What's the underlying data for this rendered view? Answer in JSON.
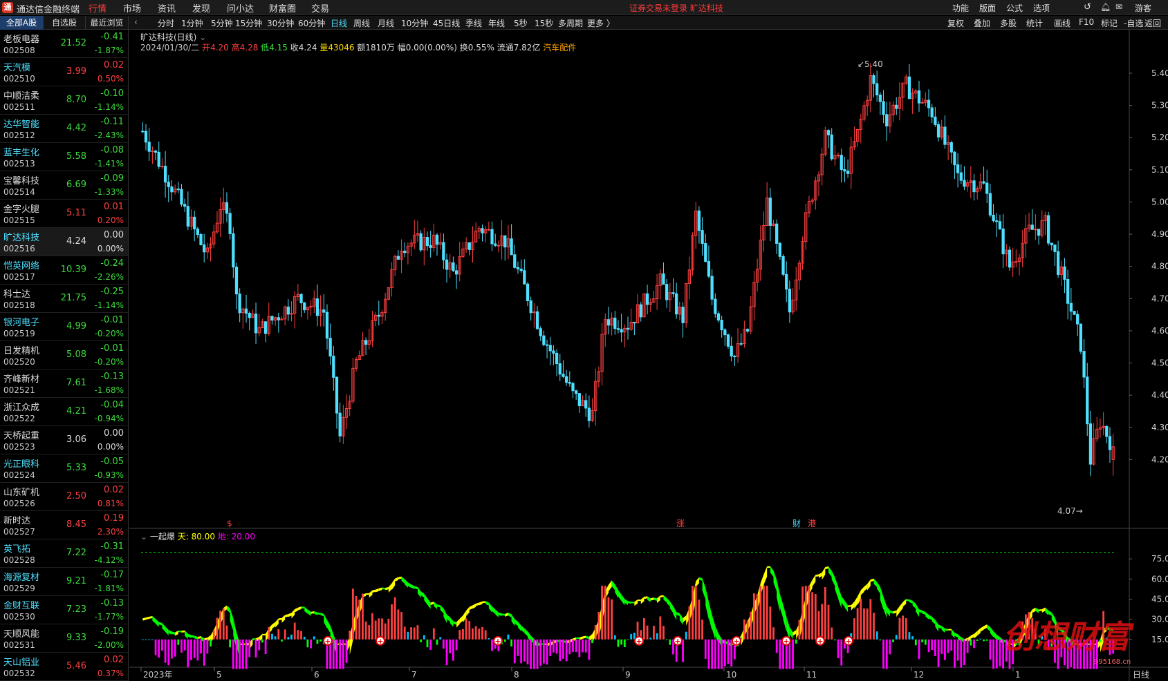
{
  "app": {
    "title": "通达信金融终端",
    "logo": "通"
  },
  "menu": [
    "行情",
    "市场",
    "资讯",
    "发现",
    "问小达",
    "财富圈",
    "交易"
  ],
  "notice": "证券交易未登录  旷达科技",
  "top_right": [
    "功能",
    "版面",
    "公式",
    "选项"
  ],
  "user": "游客",
  "left_tabs": [
    "全部A股",
    "自选股",
    "最近浏览"
  ],
  "periods": [
    "分时",
    "1分钟",
    "5分钟",
    "15分钟",
    "30分钟",
    "60分钟",
    "日线",
    "周线",
    "月线",
    "10分钟",
    "45日线",
    "季线",
    "年线",
    "5秒",
    "15秒",
    "多周期",
    "更多 〉"
  ],
  "right_tools": [
    "复权",
    "叠加",
    "多股",
    "统计",
    "画线",
    "F10",
    "标记",
    "-自选",
    "返回"
  ],
  "stocks": [
    {
      "name": "老板电器",
      "code": "002508",
      "price": "21.52",
      "chg": "-0.41",
      "pct": "-1.87%",
      "dir": "dn",
      "cy": false
    },
    {
      "name": "天汽模",
      "code": "002510",
      "price": "3.99",
      "chg": "0.02",
      "pct": "0.50%",
      "dir": "up",
      "cy": true
    },
    {
      "name": "中顺洁柔",
      "code": "002511",
      "price": "8.70",
      "chg": "-0.10",
      "pct": "-1.14%",
      "dir": "dn",
      "cy": false
    },
    {
      "name": "达华智能",
      "code": "002512",
      "price": "4.42",
      "chg": "-0.11",
      "pct": "-2.43%",
      "dir": "dn",
      "cy": true
    },
    {
      "name": "蓝丰生化",
      "code": "002513",
      "price": "5.58",
      "chg": "-0.08",
      "pct": "-1.41%",
      "dir": "dn",
      "cy": true
    },
    {
      "name": "宝馨科技",
      "code": "002514",
      "price": "6.69",
      "chg": "-0.09",
      "pct": "-1.33%",
      "dir": "dn",
      "cy": false
    },
    {
      "name": "金字火腿",
      "code": "002515",
      "price": "5.11",
      "chg": "0.01",
      "pct": "0.20%",
      "dir": "up",
      "cy": false
    },
    {
      "name": "旷达科技",
      "code": "002516",
      "price": "4.24",
      "chg": "0.00",
      "pct": "0.00%",
      "dir": "eq",
      "cy": true
    },
    {
      "name": "恺英网络",
      "code": "002517",
      "price": "10.39",
      "chg": "-0.24",
      "pct": "-2.26%",
      "dir": "dn",
      "cy": true
    },
    {
      "name": "科士达",
      "code": "002518",
      "price": "21.75",
      "chg": "-0.25",
      "pct": "-1.14%",
      "dir": "dn",
      "cy": false
    },
    {
      "name": "银河电子",
      "code": "002519",
      "price": "4.99",
      "chg": "-0.01",
      "pct": "-0.20%",
      "dir": "dn",
      "cy": true
    },
    {
      "name": "日发精机",
      "code": "002520",
      "price": "5.08",
      "chg": "-0.01",
      "pct": "-0.20%",
      "dir": "dn",
      "cy": false
    },
    {
      "name": "齐峰新材",
      "code": "002521",
      "price": "7.61",
      "chg": "-0.13",
      "pct": "-1.68%",
      "dir": "dn",
      "cy": false
    },
    {
      "name": "浙江众成",
      "code": "002522",
      "price": "4.21",
      "chg": "-0.04",
      "pct": "-0.94%",
      "dir": "dn",
      "cy": false
    },
    {
      "name": "天桥起重",
      "code": "002523",
      "price": "3.06",
      "chg": "0.00",
      "pct": "0.00%",
      "dir": "eq",
      "cy": false
    },
    {
      "name": "光正眼科",
      "code": "002524",
      "price": "5.33",
      "chg": "-0.05",
      "pct": "-0.93%",
      "dir": "dn",
      "cy": true
    },
    {
      "name": "山东矿机",
      "code": "002526",
      "price": "2.50",
      "chg": "0.02",
      "pct": "0.81%",
      "dir": "up",
      "cy": false
    },
    {
      "name": "新时达",
      "code": "002527",
      "price": "8.45",
      "chg": "0.19",
      "pct": "2.30%",
      "dir": "up",
      "cy": false
    },
    {
      "name": "英飞拓",
      "code": "002528",
      "price": "7.22",
      "chg": "-0.31",
      "pct": "-4.12%",
      "dir": "dn",
      "cy": true
    },
    {
      "name": "海源复材",
      "code": "002529",
      "price": "9.21",
      "chg": "-0.17",
      "pct": "-1.81%",
      "dir": "dn",
      "cy": true
    },
    {
      "name": "金财互联",
      "code": "002530",
      "price": "7.23",
      "chg": "-0.13",
      "pct": "-1.77%",
      "dir": "dn",
      "cy": true
    },
    {
      "name": "天顺风能",
      "code": "002531",
      "price": "9.33",
      "chg": "-0.19",
      "pct": "-2.00%",
      "dir": "dn",
      "cy": false
    },
    {
      "name": "天山铝业",
      "code": "002532",
      "price": "5.46",
      "chg": "0.02",
      "pct": "0.37%",
      "dir": "up",
      "cy": true
    }
  ],
  "chart": {
    "stock_title": "旷达科技(日线)",
    "date": "2024/01/30/二",
    "open_label": "开",
    "open": "4.20",
    "high_label": "高",
    "high": "4.28",
    "low_label": "低",
    "low": "4.15",
    "close_label": "收",
    "close": "4.24",
    "vol_label": "量",
    "vol": "43046",
    "amt": "额1810万",
    "amp": "幅0.00(0.00%)",
    "turn": "换0.55%",
    "float": "流通7.82亿",
    "sector": "汽车配件",
    "max_mark": "5.40",
    "min_mark": "4.07",
    "period_label": "日线",
    "events": [
      {
        "t": "$",
        "c": "#ff4040"
      },
      {
        "t": "涨",
        "c": "#ff4040"
      },
      {
        "t": "财",
        "c": "#4fe0ff"
      },
      {
        "t": "港",
        "c": "#ff4040"
      }
    ]
  },
  "indicator": {
    "name": "一起爆",
    "tian_label": "天:",
    "tian": "80.00",
    "di_label": "地:",
    "di": "20.00"
  },
  "watermark": {
    "text": "创想财富",
    "url": "995168.cn"
  },
  "colors": {
    "up": "#ff4040",
    "down": "#4fe0ff",
    "yellow": "#ffff00",
    "green": "#00ff00",
    "magenta": "#ff00ff"
  },
  "chart_data": {
    "type": "candlestick",
    "price_axis": {
      "ticks": [
        "5.40",
        "5.30",
        "5.20",
        "5.10",
        "5.00",
        "4.90",
        "4.80",
        "4.70",
        "4.60",
        "4.50",
        "4.40",
        "4.30",
        "4.20"
      ],
      "range": [
        4.04,
        5.46
      ]
    },
    "x_labels": [
      "2023年",
      "5",
      "6",
      "7",
      "8",
      "9",
      "10",
      "11",
      "12",
      "1"
    ],
    "indicator_axis": {
      "ticks": [
        "75.00",
        "60.00",
        "45.00",
        "30.00",
        "15.00"
      ],
      "range": [
        0,
        90
      ]
    },
    "waypoints": [
      [
        0,
        5.22
      ],
      [
        8,
        5.07
      ],
      [
        14,
        4.95
      ],
      [
        20,
        4.83
      ],
      [
        24,
        4.99
      ],
      [
        27,
        4.93
      ],
      [
        29,
        4.7
      ],
      [
        36,
        4.6
      ],
      [
        48,
        4.7
      ],
      [
        56,
        4.66
      ],
      [
        61,
        4.27
      ],
      [
        66,
        4.5
      ],
      [
        73,
        4.65
      ],
      [
        80,
        4.87
      ],
      [
        90,
        4.88
      ],
      [
        96,
        4.78
      ],
      [
        104,
        4.92
      ],
      [
        112,
        4.88
      ],
      [
        117,
        4.76
      ],
      [
        124,
        4.58
      ],
      [
        133,
        4.4
      ],
      [
        139,
        4.34
      ],
      [
        143,
        4.64
      ],
      [
        150,
        4.62
      ],
      [
        160,
        4.75
      ],
      [
        167,
        4.64
      ],
      [
        171,
        4.96
      ],
      [
        176,
        4.7
      ],
      [
        183,
        4.52
      ],
      [
        187,
        4.6
      ],
      [
        193,
        5.0
      ],
      [
        200,
        4.66
      ],
      [
        204,
        4.9
      ],
      [
        211,
        5.2
      ],
      [
        217,
        5.08
      ],
      [
        221,
        5.21
      ],
      [
        225,
        5.38
      ],
      [
        230,
        5.26
      ],
      [
        236,
        5.36
      ],
      [
        244,
        5.28
      ],
      [
        252,
        5.08
      ],
      [
        260,
        5.05
      ],
      [
        268,
        4.8
      ],
      [
        274,
        4.91
      ],
      [
        279,
        4.93
      ],
      [
        284,
        4.77
      ],
      [
        290,
        4.56
      ],
      [
        293,
        4.2
      ],
      [
        296,
        4.32
      ],
      [
        300,
        4.24
      ]
    ]
  }
}
